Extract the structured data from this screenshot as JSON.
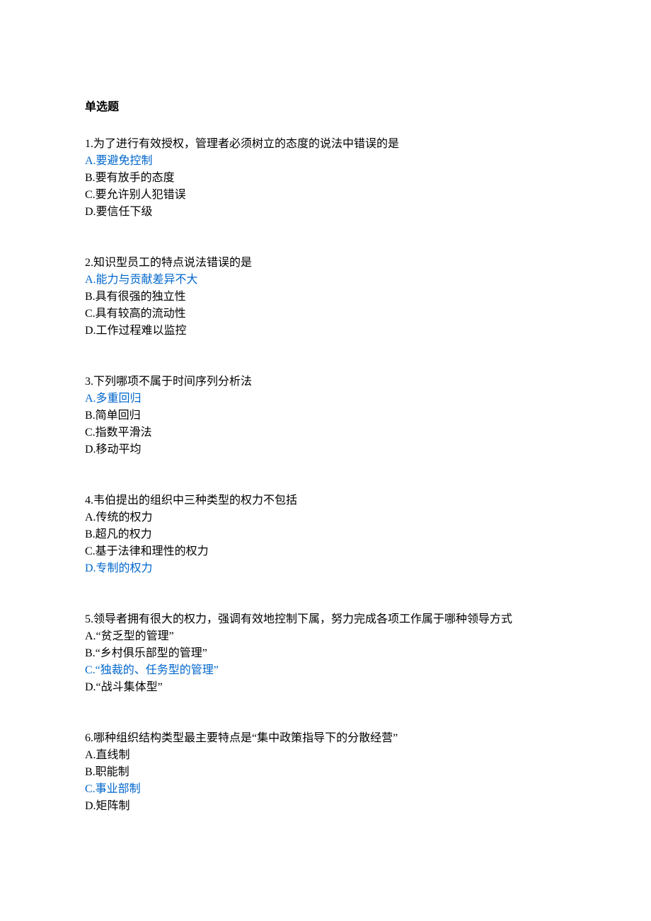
{
  "section_title": "单选题",
  "questions": [
    {
      "stem": "1.为了进行有效授权，管理者必须树立的态度的说法中错误的是",
      "options": [
        {
          "text": "A.要避免控制",
          "is_answer": true
        },
        {
          "text": "B.要有放手的态度",
          "is_answer": false
        },
        {
          "text": "C.要允许别人犯错误",
          "is_answer": false
        },
        {
          "text": "D.要信任下级",
          "is_answer": false
        }
      ]
    },
    {
      "stem": "2.知识型员工的特点说法错误的是",
      "options": [
        {
          "text": "A.能力与贡献差异不大",
          "is_answer": true
        },
        {
          "text": "B.具有很强的独立性",
          "is_answer": false
        },
        {
          "text": "C.具有较高的流动性",
          "is_answer": false
        },
        {
          "text": "D.工作过程难以监控",
          "is_answer": false
        }
      ]
    },
    {
      "stem": "3.下列哪项不属于时间序列分析法",
      "options": [
        {
          "text": "A.多重回归",
          "is_answer": true
        },
        {
          "text": "B.简单回归",
          "is_answer": false
        },
        {
          "text": "C.指数平滑法",
          "is_answer": false
        },
        {
          "text": "D.移动平均",
          "is_answer": false
        }
      ]
    },
    {
      "stem": "4.韦伯提出的组织中三种类型的权力不包括",
      "options": [
        {
          "text": "A.传统的权力",
          "is_answer": false
        },
        {
          "text": "B.超凡的权力",
          "is_answer": false
        },
        {
          "text": "C.基于法律和理性的权力",
          "is_answer": false
        },
        {
          "text": "D.专制的权力",
          "is_answer": true
        }
      ]
    },
    {
      "stem": "5.领导者拥有很大的权力，强调有效地控制下属，努力完成各项工作属于哪种领导方式",
      "options": [
        {
          "text": "A.“贫乏型的管理”",
          "is_answer": false
        },
        {
          "text": "B.“乡村俱乐部型的管理”",
          "is_answer": false
        },
        {
          "text": "C.“独裁的、任务型的管理”",
          "is_answer": true
        },
        {
          "text": "D.“战斗集体型”",
          "is_answer": false
        }
      ]
    },
    {
      "stem": "6.哪种组织结构类型最主要特点是“集中政策指导下的分散经营”",
      "options": [
        {
          "text": "A.直线制",
          "is_answer": false
        },
        {
          "text": "B.职能制",
          "is_answer": false
        },
        {
          "text": "C.事业部制",
          "is_answer": true
        },
        {
          "text": "D.矩阵制",
          "is_answer": false
        }
      ]
    }
  ]
}
